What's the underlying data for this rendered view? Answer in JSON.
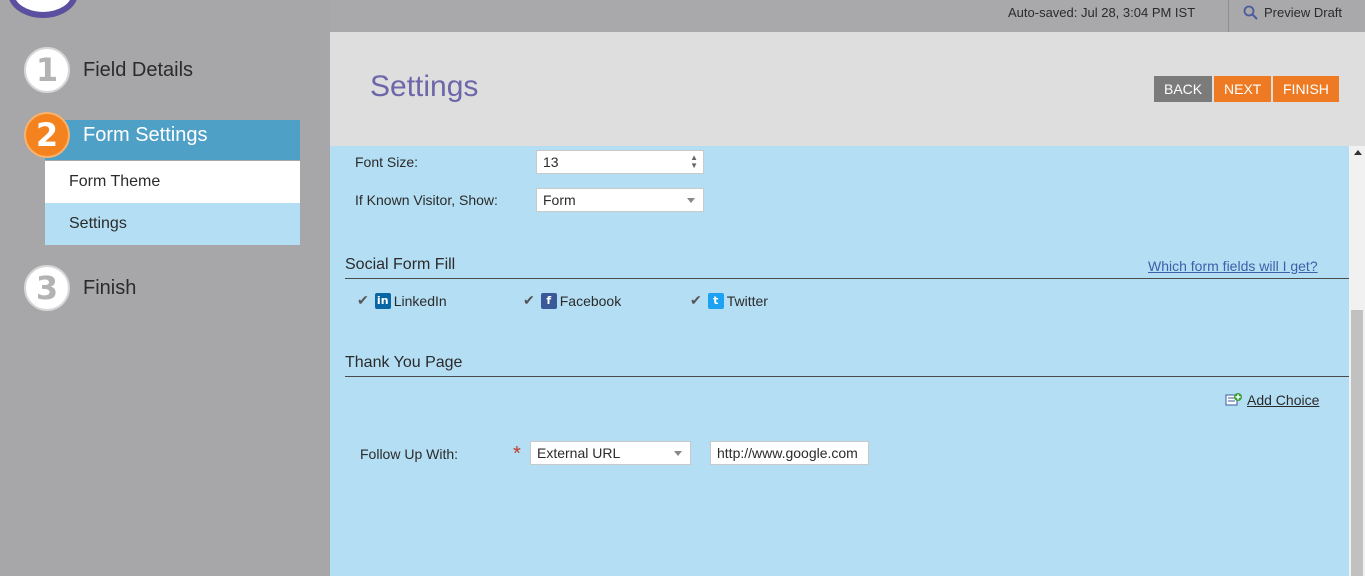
{
  "sidebar": {
    "steps": [
      {
        "num": "1",
        "label": "Field Details"
      },
      {
        "num": "2",
        "label": "Form Settings",
        "subitems": [
          "Form Theme",
          "Settings"
        ]
      },
      {
        "num": "3",
        "label": "Finish"
      }
    ]
  },
  "topbar": {
    "autosave": "Auto-saved: Jul 28, 3:04 PM IST",
    "preview": "Preview Draft"
  },
  "header": {
    "title": "Settings",
    "buttons": {
      "back": "BACK",
      "next": "NEXT",
      "finish": "FINISH"
    }
  },
  "form": {
    "font_size": {
      "label": "Font Size:",
      "value": "13"
    },
    "known_visitor": {
      "label": "If Known Visitor, Show:",
      "value": "Form"
    },
    "social": {
      "title": "Social Form Fill",
      "help_link": "Which form fields will I get?",
      "options": [
        {
          "label": "LinkedIn",
          "checked": true,
          "icon": "linkedin-icon"
        },
        {
          "label": "Facebook",
          "checked": true,
          "icon": "facebook-icon"
        },
        {
          "label": "Twitter",
          "checked": true,
          "icon": "twitter-icon"
        }
      ]
    },
    "thank_you": {
      "title": "Thank You Page",
      "add_choice": "Add Choice",
      "follow_up_label": "Follow Up With:",
      "required_mark": "*",
      "follow_up_value": "External URL",
      "url_value": "http://www.google.com"
    }
  },
  "colors": {
    "accent_orange": "#ee7b23",
    "step_active": "#4fa0c7",
    "content_bg": "#b4def3",
    "title_purple": "#6c67a8"
  }
}
